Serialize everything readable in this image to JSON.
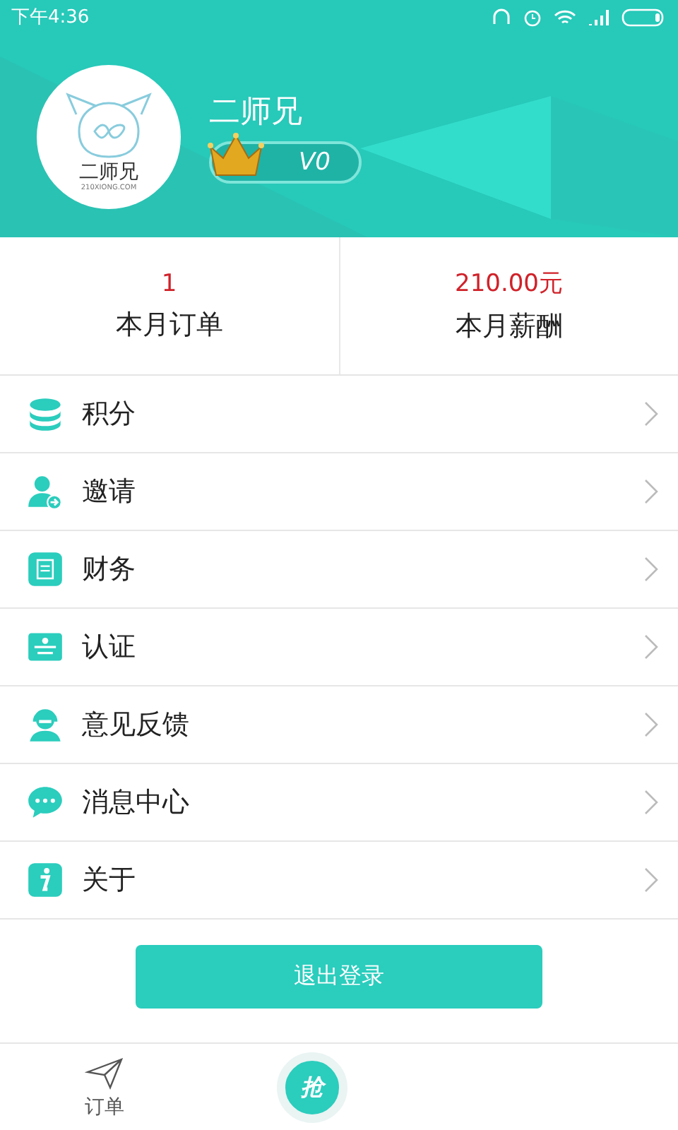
{
  "status_bar": {
    "time": "下午4:36"
  },
  "profile": {
    "avatar_title": "二师兄",
    "avatar_site": "210XIONG.COM",
    "name": "二师兄",
    "level": "V0"
  },
  "stats": [
    {
      "value": "1",
      "label": "本月订单"
    },
    {
      "value": "210.00元",
      "label": "本月薪酬"
    }
  ],
  "menu": [
    {
      "label": "积分"
    },
    {
      "label": "邀请"
    },
    {
      "label": "财务"
    },
    {
      "label": "认证"
    },
    {
      "label": "意见反馈"
    },
    {
      "label": "消息中心"
    },
    {
      "label": "关于"
    }
  ],
  "logout_button": "退出登录",
  "tab_bar": {
    "tabs": [
      {
        "label": "订单",
        "selected": false
      }
    ],
    "center_button": "抢"
  }
}
